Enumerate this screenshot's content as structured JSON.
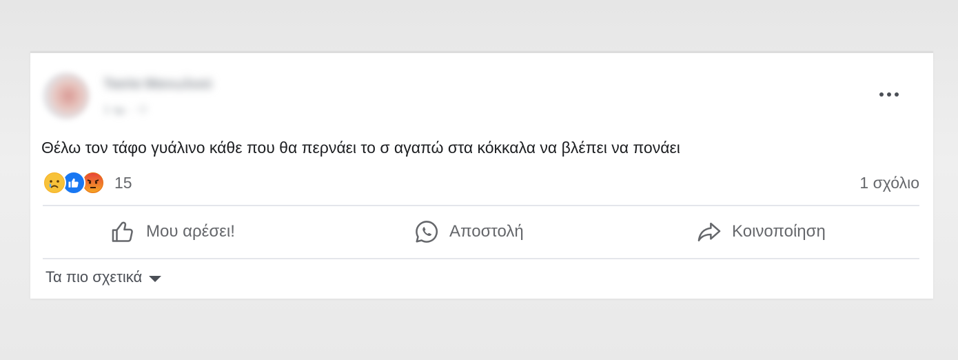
{
  "post": {
    "author": "Τασία Μανωλιού",
    "time": "1 ημ. · ⚇",
    "text": "Θέλω τον τάφο γυάλινο κάθε που θα περνάει το σ αγαπώ στα κόκκαλα να βλέπει να πονάει"
  },
  "reactions": {
    "icons": [
      "sad-reaction-icon",
      "like-reaction-icon",
      "angry-reaction-icon"
    ],
    "count": "15"
  },
  "comments": {
    "label": "1 σχόλιο"
  },
  "actions": {
    "like": "Μου αρέσει!",
    "send": "Αποστολή",
    "share": "Κοινοποίηση"
  },
  "sort": {
    "label": "Τα πιο σχετικά"
  },
  "colors": {
    "like_blue": "#1877f2",
    "sad_yellow": "#f7b125",
    "angry_red": "#e9710f",
    "muted_text": "#65676b",
    "divider": "#e4e6eb"
  }
}
